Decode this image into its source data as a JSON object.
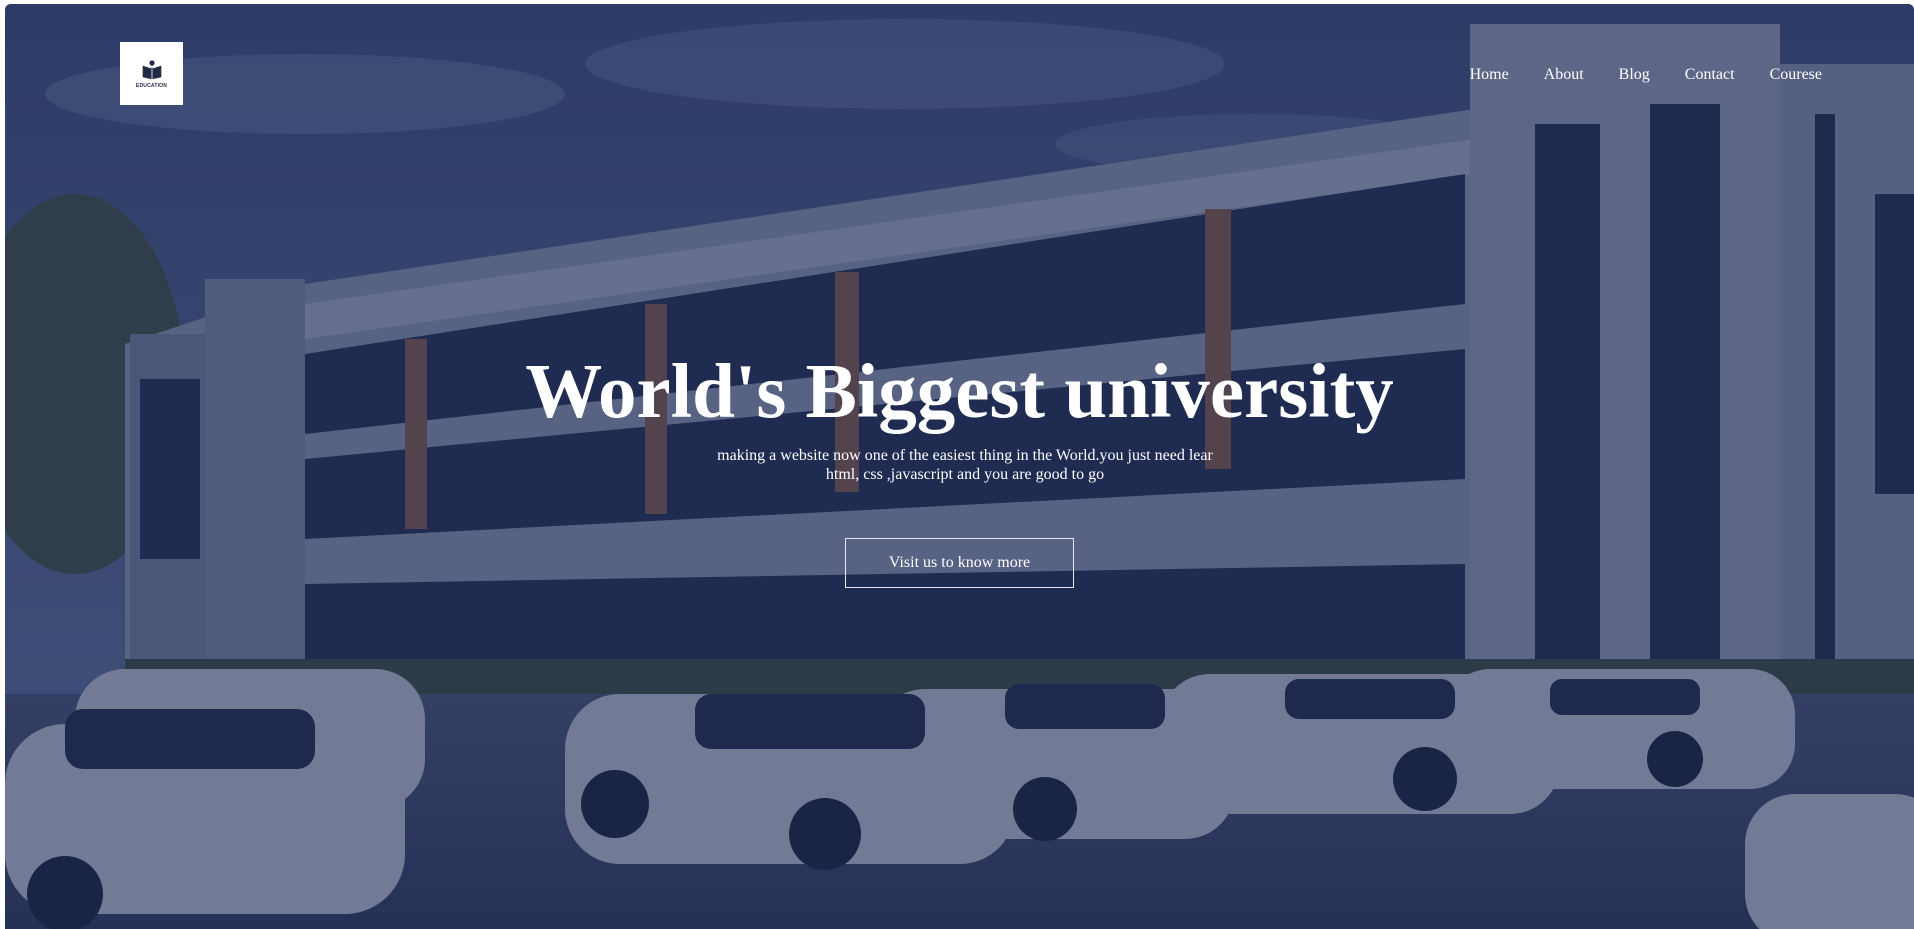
{
  "header": {
    "logo_text": "EDUCATION",
    "nav": [
      {
        "label": "Home"
      },
      {
        "label": "About"
      },
      {
        "label": "Blog"
      },
      {
        "label": "Contact"
      },
      {
        "label": "Courese"
      }
    ]
  },
  "hero": {
    "title": "World's Biggest university",
    "subtitle_line1": "making a website now one of the easiest thing in the World.you just need lear",
    "subtitle_line2": "html, css ,javascript and you are good to go",
    "cta_label": "Visit us to know more"
  },
  "icons": {
    "logo": "book-reader-icon"
  },
  "colors": {
    "overlay": "#16224e",
    "text": "#ffffff",
    "button_border": "#e6e8f0"
  }
}
